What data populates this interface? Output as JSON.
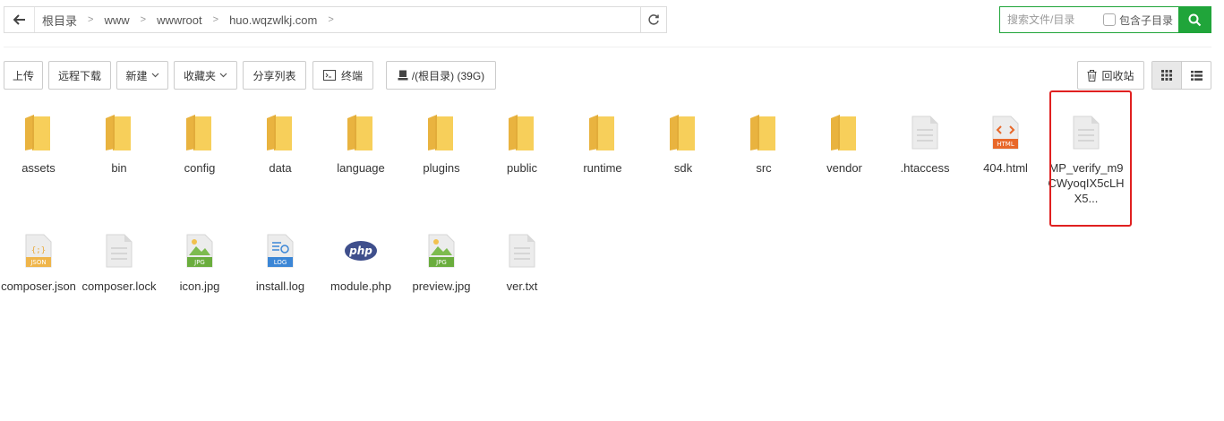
{
  "breadcrumb": [
    "根目录",
    "www",
    "wwwroot",
    "huo.wqzwlkj.com"
  ],
  "search": {
    "placeholder": "搜索文件/目录",
    "include_subdirs_label": "包含子目录"
  },
  "toolbar": {
    "upload": "上传",
    "remote_download": "远程下载",
    "new": "新建",
    "favorites": "收藏夹",
    "share_list": "分享列表",
    "terminal": "终端",
    "disk": "/(根目录) (39G)",
    "recycle_bin": "回收站"
  },
  "colors": {
    "accent": "#20a53a",
    "highlight": "#e02020",
    "folder": "#f5c94e"
  },
  "files": [
    {
      "name": "assets",
      "icon": "folder-icon"
    },
    {
      "name": "bin",
      "icon": "folder-icon"
    },
    {
      "name": "config",
      "icon": "folder-icon"
    },
    {
      "name": "data",
      "icon": "folder-icon"
    },
    {
      "name": "language",
      "icon": "folder-icon"
    },
    {
      "name": "plugins",
      "icon": "folder-icon"
    },
    {
      "name": "public",
      "icon": "folder-icon"
    },
    {
      "name": "runtime",
      "icon": "folder-icon"
    },
    {
      "name": "sdk",
      "icon": "folder-icon"
    },
    {
      "name": "src",
      "icon": "folder-icon"
    },
    {
      "name": "vendor",
      "icon": "folder-icon"
    },
    {
      "name": ".htaccess",
      "icon": "file-icon"
    },
    {
      "name": "404.html",
      "icon": "html-file-icon",
      "badge": "HTML"
    },
    {
      "name": "MP_verify_m9CWyoqIX5cLHX5...",
      "icon": "file-icon"
    },
    {
      "name": "composer.json",
      "icon": "json-file-icon",
      "badge": "JSON"
    },
    {
      "name": "composer.lock",
      "icon": "file-icon"
    },
    {
      "name": "icon.jpg",
      "icon": "image-file-icon",
      "badge": "JPG"
    },
    {
      "name": "install.log",
      "icon": "log-file-icon",
      "badge": "LOG"
    },
    {
      "name": "module.php",
      "icon": "php-file-icon",
      "badge": "php"
    },
    {
      "name": "preview.jpg",
      "icon": "image-file-icon",
      "badge": "JPG"
    },
    {
      "name": "ver.txt",
      "icon": "file-icon"
    }
  ]
}
